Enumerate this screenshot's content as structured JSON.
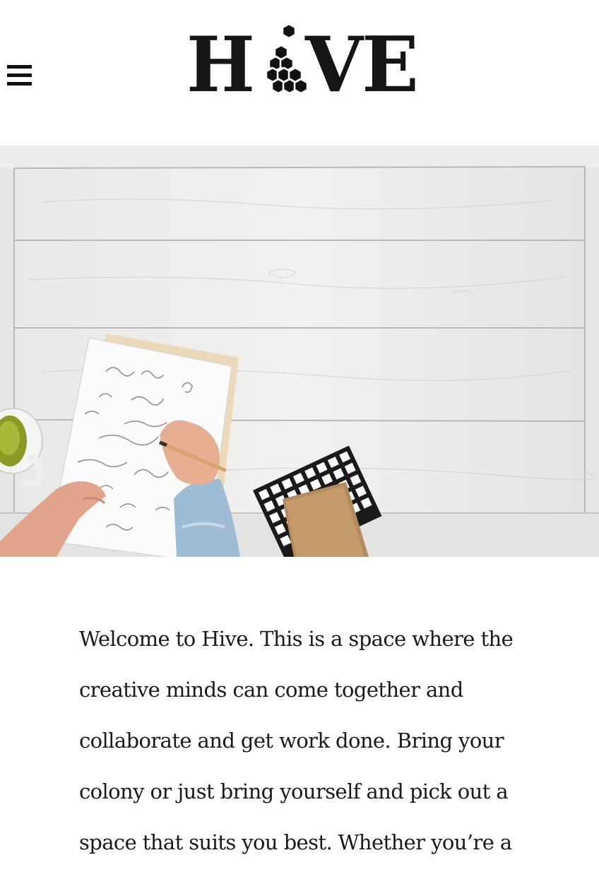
{
  "header": {
    "menu_icon": "hamburger-menu-icon",
    "logo_text_left": "H",
    "logo_text_right": "VE",
    "logo_icon": "honeycomb-icon"
  },
  "hero": {
    "image": "desk-workspace-photo"
  },
  "intro": {
    "lines": [
      "Welcome to Hive. This is a space where the",
      "creative minds can come together and",
      "collaborate and get work done. Bring your",
      "colony or just bring yourself and pick out a",
      "space that suits you best. Whether you’re a"
    ]
  }
}
